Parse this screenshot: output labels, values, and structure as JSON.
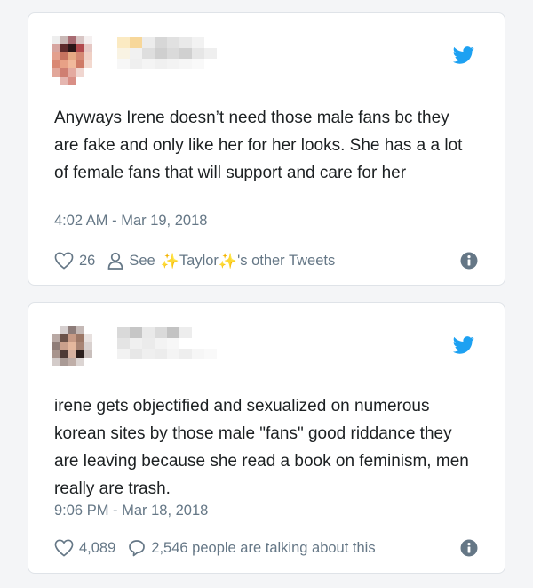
{
  "tweets": [
    {
      "text": "Anyways Irene doesn’t need those male fans bc they are fake and only like her for her looks. She has a a lot of female fans that will support and care for her",
      "timestamp": "4:02 AM - Mar 19, 2018",
      "likes": "26",
      "see_prefix": "See",
      "sparkle": "✨",
      "profile_name": "Taylor",
      "see_suffix": "'s other Tweets"
    },
    {
      "text": "irene gets objectified and sexualized on numerous korean sites by those male \"fans\" good riddance they are leaving because she read a book on feminism, men really are trash.",
      "timestamp": "9:06 PM - Mar 18, 2018",
      "likes": "4,089",
      "talking": "2,546 people are talking about this"
    }
  ],
  "icons": {
    "brand": "twitter-bird-icon",
    "like": "heart-icon",
    "person": "person-icon",
    "reply": "speech-bubble-icon",
    "info": "info-icon"
  },
  "colors": {
    "twitter_blue": "#1da1f2",
    "text": "#1c2022",
    "meta": "#657786",
    "card_border": "#dfe3e8"
  }
}
